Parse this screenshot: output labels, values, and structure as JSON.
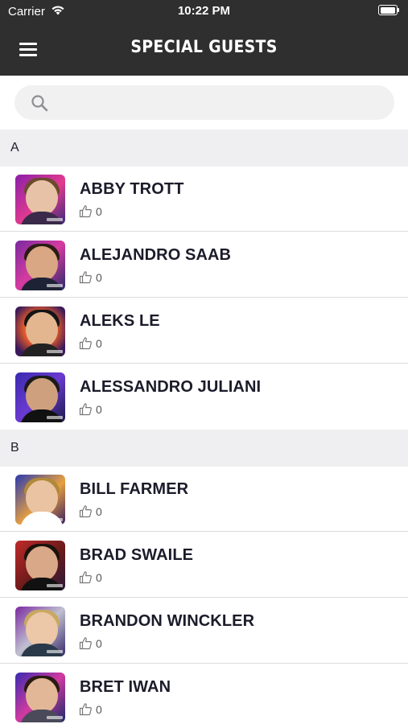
{
  "status_bar": {
    "carrier": "Carrier",
    "time": "10:22 PM"
  },
  "nav": {
    "title": "SPECIAL GUESTS",
    "menu_icon": "hamburger-menu-icon"
  },
  "search": {
    "placeholder": "",
    "value": "",
    "icon": "search-icon"
  },
  "sections": [
    {
      "letter": "A",
      "guests": [
        {
          "name": "ABBY TROTT",
          "likes": "0"
        },
        {
          "name": "ALEJANDRO SAAB",
          "likes": "0"
        },
        {
          "name": "ALEKS LE",
          "likes": "0"
        },
        {
          "name": "ALESSANDRO JULIANI",
          "likes": "0"
        }
      ]
    },
    {
      "letter": "B",
      "guests": [
        {
          "name": "BILL FARMER",
          "likes": "0"
        },
        {
          "name": "BRAD SWAILE",
          "likes": "0"
        },
        {
          "name": "BRANDON WINCKLER",
          "likes": "0"
        },
        {
          "name": "BRET IWAN",
          "likes": "0"
        }
      ]
    }
  ],
  "colors": {
    "header_bg": "#2f2f2f",
    "section_bg": "#efeff1",
    "search_bg": "#f1f1f1",
    "name_text": "#1b1b2a"
  }
}
